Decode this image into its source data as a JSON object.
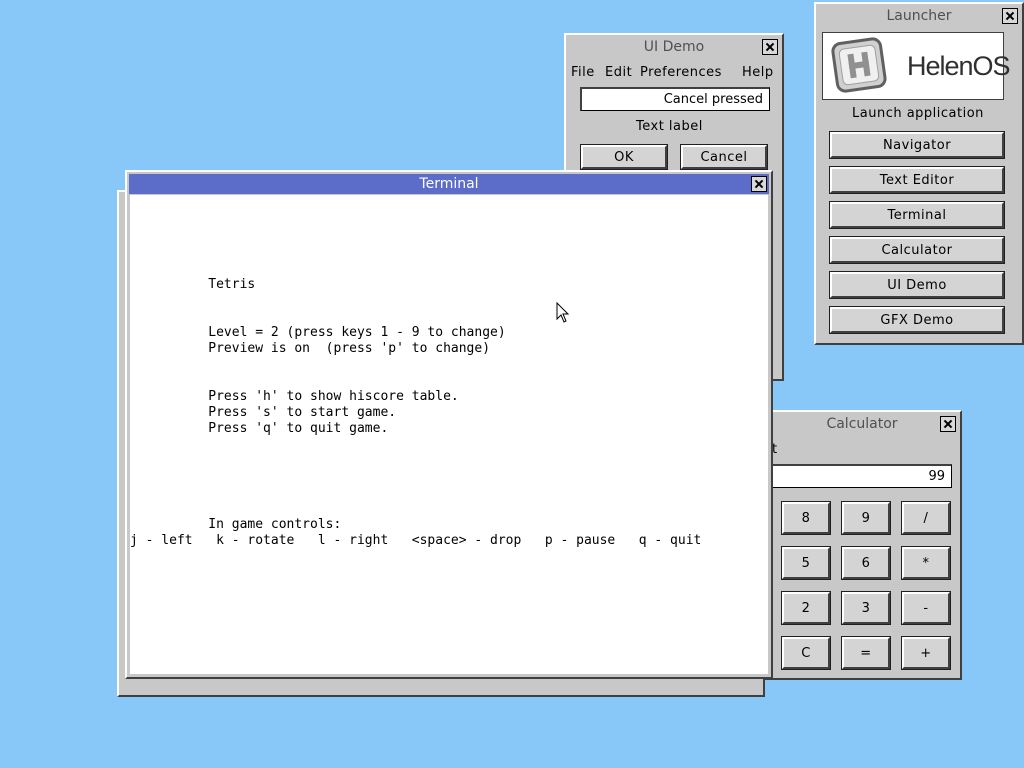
{
  "launcher": {
    "title": "Launcher",
    "logo_text": "HelenOS",
    "subtitle": "Launch application",
    "buttons": [
      "Navigator",
      "Text Editor",
      "Terminal",
      "Calculator",
      "UI Demo",
      "GFX Demo"
    ]
  },
  "uidemo": {
    "title": "UI Demo",
    "menu": [
      "File",
      "Edit",
      "Preferences",
      "Help"
    ],
    "entry_value": "Cancel pressed",
    "label": "Text label",
    "ok": "OK",
    "cancel": "Cancel"
  },
  "calculator": {
    "title": "Calculator",
    "menu_partial": "t",
    "display": "99",
    "keys": [
      "8",
      "9",
      "/",
      "5",
      "6",
      "*",
      "2",
      "3",
      "-",
      "C",
      "=",
      "+"
    ]
  },
  "terminal": {
    "title": "Terminal",
    "lines": [
      "          Tetris",
      "          Level = 2 (press keys 1 - 9 to change)",
      "          Preview is on  (press 'p' to change)",
      "          Press 'h' to show hiscore table.",
      "          Press 's' to start game.",
      "          Press 'q' to quit game.",
      "          In game controls:",
      "j - left   k - rotate   l - right   <space> - drop   p - pause   q - quit"
    ]
  },
  "colors": {
    "desktop": "#87c8f8",
    "active_title": "#5b6dc8"
  }
}
